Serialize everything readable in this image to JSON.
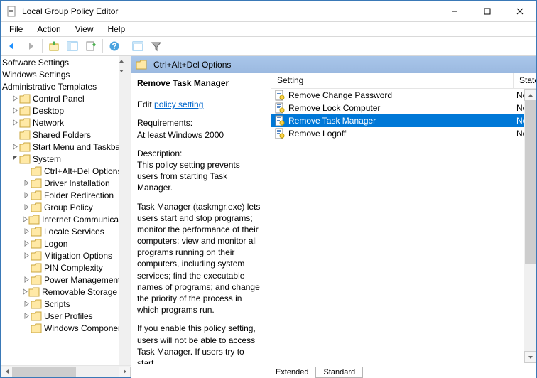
{
  "window": {
    "title": "Local Group Policy Editor"
  },
  "menu": {
    "file": "File",
    "action": "Action",
    "view": "View",
    "help": "Help"
  },
  "tree": {
    "roots": [
      {
        "label": "Software Settings"
      },
      {
        "label": "Windows Settings"
      },
      {
        "label": "Administrative Templates"
      }
    ],
    "admin_children": [
      "Control Panel",
      "Desktop",
      "Network",
      "Shared Folders",
      "Start Menu and Taskbar",
      "System"
    ],
    "system_children": [
      "Ctrl+Alt+Del Options",
      "Driver Installation",
      "Folder Redirection",
      "Group Policy",
      "Internet Communication Management",
      "Locale Services",
      "Logon",
      "Mitigation Options",
      "PIN Complexity",
      "Power Management",
      "Removable Storage Access",
      "Scripts",
      "User Profiles",
      "Windows Components"
    ],
    "selected": "Ctrl+Alt+Del Options"
  },
  "header": {
    "title": "Ctrl+Alt+Del Options"
  },
  "details": {
    "title": "Remove Task Manager",
    "edit_prefix": "Edit ",
    "edit_link": "policy setting",
    "req_label": "Requirements:",
    "req_value": "At least Windows 2000",
    "desc_label": "Description:",
    "desc_p1": "This policy setting prevents users from starting Task Manager.",
    "desc_p2": "Task Manager (taskmgr.exe) lets users start and stop programs; monitor the performance of their computers; view and monitor all programs running on their computers, including system services; find the executable names of programs; and change the priority of the process in which programs run.",
    "desc_p3": "If you enable this policy setting, users will not be able to access Task Manager. If users try to start"
  },
  "list": {
    "col_setting": "Setting",
    "col_state": "State",
    "rows": [
      {
        "label": "Remove Change Password",
        "state": "Not configured",
        "selected": false
      },
      {
        "label": "Remove Lock Computer",
        "state": "Not configured",
        "selected": false
      },
      {
        "label": "Remove Task Manager",
        "state": "Not configured",
        "selected": true
      },
      {
        "label": "Remove Logoff",
        "state": "Not configured",
        "selected": false
      }
    ]
  },
  "tabs": {
    "extended": "Extended",
    "standard": "Standard",
    "active": "Extended"
  }
}
